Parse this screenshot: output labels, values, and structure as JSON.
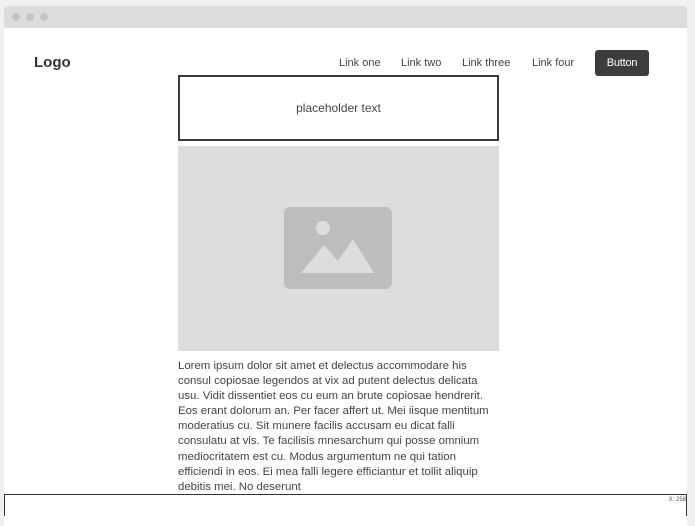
{
  "header": {
    "logo": "Logo",
    "nav_links": [
      "Link one",
      "Link two",
      "Link three",
      "Link four"
    ],
    "button_label": "Button"
  },
  "content": {
    "placeholder": "placeholder text",
    "image_icon": "image-placeholder-icon",
    "paragraph": "Lorem ipsum dolor sit amet et delectus accommodare his consul copiosae legendos at vix ad putent delectus delicata usu. Vidit dissentiet eos cu eum an brute copiosae hendrerit. Eos erant dolorum an. Per facer affert ut. Mei iisque mentitum moderatius cu. Sit munere facilis accusam eu dicat falli consulatu at vis. Te facilisis mnesarchum qui posse omnium mediocritatem est cu. Modus argumentum ne qui tation efficiendi in eos. Ei mea falli legere efficiantur et tollit aliquip debitis mei. No deserunt"
  },
  "footer": {
    "coordinate_readout": "X: 258"
  },
  "colors": {
    "button_bg": "#3d3d3d",
    "image_bg": "#dddddd",
    "image_icon": "#bdbdbd",
    "titlebar": "#dcdcdc"
  }
}
